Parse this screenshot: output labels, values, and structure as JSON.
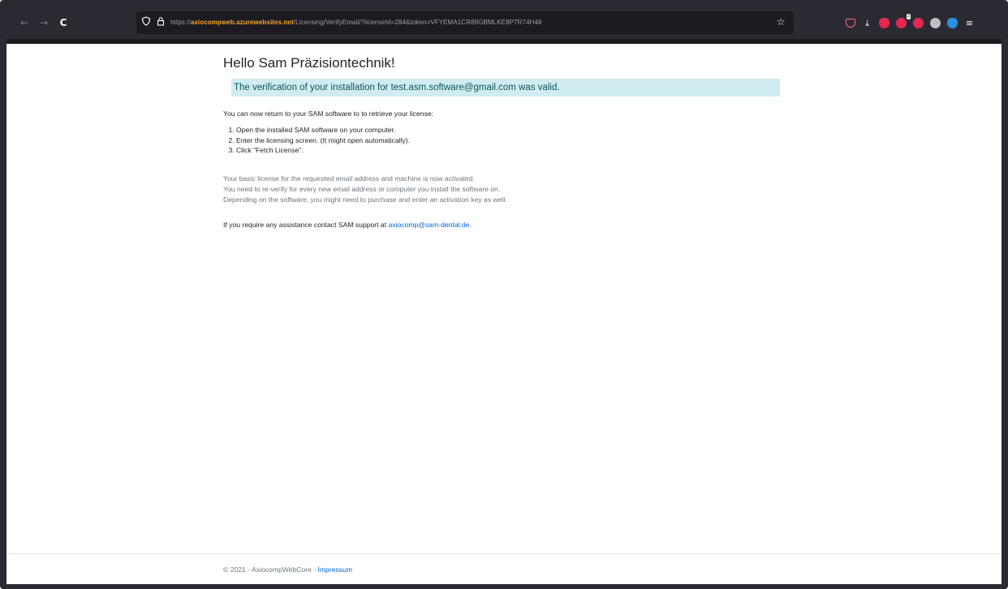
{
  "browser": {
    "back_icon": "←",
    "forward_icon": "→",
    "reload_icon": "C",
    "url_protocol": "https://",
    "url_host": "axiocompweb.azurewebsites.net",
    "url_path": "/Licensing/VerifyEmail/?licenseId=284&token=VFYEMA1CR89GBMLKE8P7R74H48",
    "extension_badge": "2",
    "extension_colors": {
      "pocket": "#ff6a75",
      "downloads": "#fbfbfe",
      "shield": "#e22850",
      "ext2": "#e22850",
      "ext3": "#e22850",
      "ext4": "#c0c0c0",
      "ext5": "#2a90d9"
    }
  },
  "page": {
    "heading": "Hello Sam Präzisiontechnik!",
    "alert": "The verification of your installation for test.asm.software@gmail.com was valid.",
    "intro": "You can now return to your SAM software to to retrieve your license:",
    "steps": [
      "Open the installed SAM software on your computer.",
      "Enter the licensing screen. (It might open automatically).",
      "Click \"Fetch License\"."
    ],
    "notes": [
      "Your basic license for the requested email address and machine is now activated.",
      "You need to re-verify for every new email address or computer you install the software on.",
      "Depending on the software, you might need to purchase and enter an activation key as well."
    ],
    "assist_prefix": "If you require any assistance contact SAM support at ",
    "assist_email": "axiocomp@sam-dental.de",
    "assist_suffix": "."
  },
  "footer": {
    "copyright": "© 2021 - AxiocompWebCore - ",
    "impressum": "Impressum"
  }
}
